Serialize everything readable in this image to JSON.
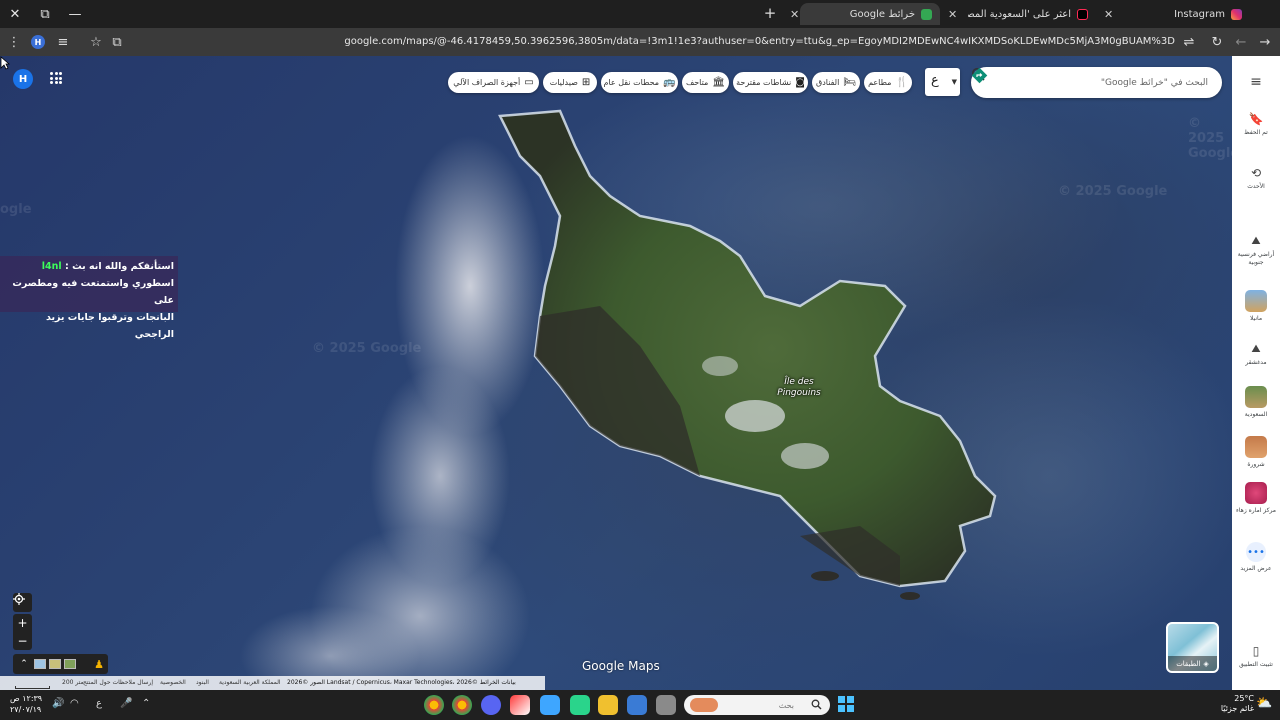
{
  "browser": {
    "tabs": [
      {
        "label": "Instagram",
        "active": false
      },
      {
        "label": "اعثر على 'السعودية المصغرة' عل...",
        "active": false
      },
      {
        "label": "خرائط Google",
        "active": true
      }
    ],
    "url": "google.com/maps/@-46.4178459,50.3962596,3805m/data=!3m1!1e3?authuser=0&entry=ttu&g_ep=EgoyMDI2MDEwNC4wIKXMDSoKLDEwMDc5MjA3M0gBUAM%3D",
    "profile_initial": "H"
  },
  "map": {
    "island_label": "Île des Pingouins",
    "watermark": "© 2025 Google",
    "watermark_short": "ogle",
    "logo": "Google Maps",
    "user_initial": "H"
  },
  "search": {
    "placeholder": "البحث في \"خرائط Google\"",
    "lang_letter": "ع"
  },
  "chips": {
    "restaurants": "مطاعم",
    "hotels": "الفنادق",
    "attractions": "نشاطات مقترحة",
    "museums": "متاحف",
    "transit": "محطات نقل عام",
    "pharmacies": "صيدليات",
    "atms": "أجهزة الصراف الآلي"
  },
  "story": {
    "badge": "l4nl",
    "line1": "استأنفكم والله انه بث :",
    "line2": "اسطوري واستمتعت فيه ومطصرت على",
    "line3": "البانجات وترقبوا جايات يزيد الراجحي"
  },
  "layers": {
    "label": "الطبقات"
  },
  "attribution": {
    "scale": "200 متر",
    "feedback": "إرسال ملاحظات حول المنتج",
    "privacy": "الخصوصية",
    "terms": "البنود",
    "country": "المملكة العربية السعودية",
    "data": "الصور ©2026 Landsat / Copernicus، Maxar Technologies، بيانات الخرائط ©2026"
  },
  "sidebar": {
    "items": [
      {
        "label": "تم الحفظ"
      },
      {
        "label": "الأحدث"
      },
      {
        "label": "أراضي فرنسية جنوبية"
      },
      {
        "label": "مانيلا"
      },
      {
        "label": "مدغشقر"
      },
      {
        "label": "السعودية"
      },
      {
        "label": "شرورة"
      },
      {
        "label": "مركز اماره زهاء"
      },
      {
        "label": "عرض المزيد"
      },
      {
        "label": "تثبيت التطبيق"
      }
    ]
  },
  "taskbar": {
    "time": "١٢:٣٩ ص",
    "date": "٢٧/٠٧/١٩",
    "lang": "ع",
    "search_placeholder": "بحث",
    "temperature": "25°C",
    "weather": "غائم جزئيًا"
  },
  "colors": {
    "chrome_bg": "#1f1f1f",
    "toolbar_bg": "#3a3a3a",
    "ocean": "#2a4272",
    "accent": "#1a73e8"
  }
}
